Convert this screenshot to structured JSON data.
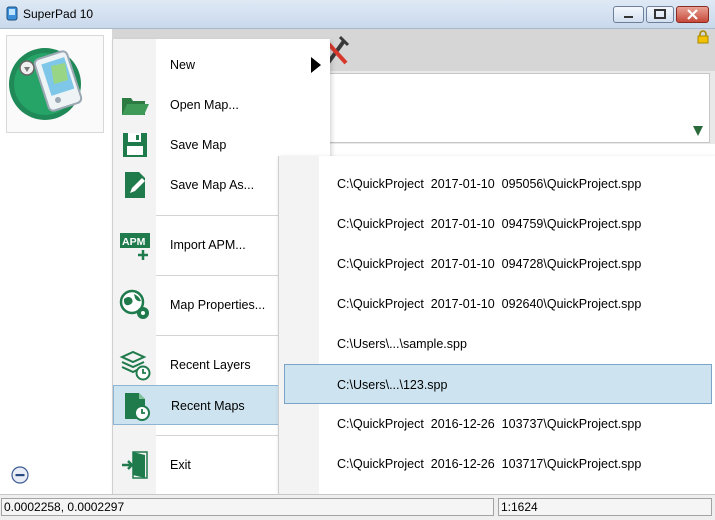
{
  "window": {
    "title": "SuperPad 10"
  },
  "file_menu": {
    "items": [
      {
        "id": "new",
        "label": "New",
        "icon": "new-icon",
        "has_submenu": true
      },
      {
        "id": "open-map",
        "label": "Open Map...",
        "icon": "folder-open-icon"
      },
      {
        "id": "save-map",
        "label": "Save Map",
        "icon": "save-icon"
      },
      {
        "id": "save-map-as",
        "label": "Save Map As...",
        "icon": "save-as-icon"
      },
      {
        "id": "import-apm",
        "label": "Import APM...",
        "icon": "apm-import-icon"
      },
      {
        "id": "map-properties",
        "label": "Map Properties...",
        "icon": "globe-settings-icon"
      },
      {
        "id": "recent-layers",
        "label": "Recent Layers",
        "icon": "layers-clock-icon"
      },
      {
        "id": "recent-maps",
        "label": "Recent Maps",
        "icon": "map-clock-icon",
        "selected": true
      },
      {
        "id": "exit",
        "label": "Exit",
        "icon": "exit-door-icon"
      }
    ]
  },
  "recent_maps": {
    "items": [
      "C:\\QuickProject  2017-01-10  095056\\QuickProject.spp",
      "C:\\QuickProject  2017-01-10  094759\\QuickProject.spp",
      "C:\\QuickProject  2017-01-10  094728\\QuickProject.spp",
      "C:\\QuickProject  2017-01-10  092640\\QuickProject.spp",
      "C:\\Users\\...\\sample.spp",
      "C:\\Users\\...\\123.spp",
      "C:\\QuickProject  2016-12-26  103737\\QuickProject.spp",
      "C:\\QuickProject  2016-12-26  103717\\QuickProject.spp"
    ],
    "selected_index": 5
  },
  "status": {
    "coordinates": "0.0002258, 0.0002297",
    "scale": "1:1624"
  },
  "colors": {
    "selection": "#cde4f0",
    "selection_border": "#7ea3c9",
    "accent_green": "#1f7a4c",
    "close_red": "#c6483a"
  }
}
